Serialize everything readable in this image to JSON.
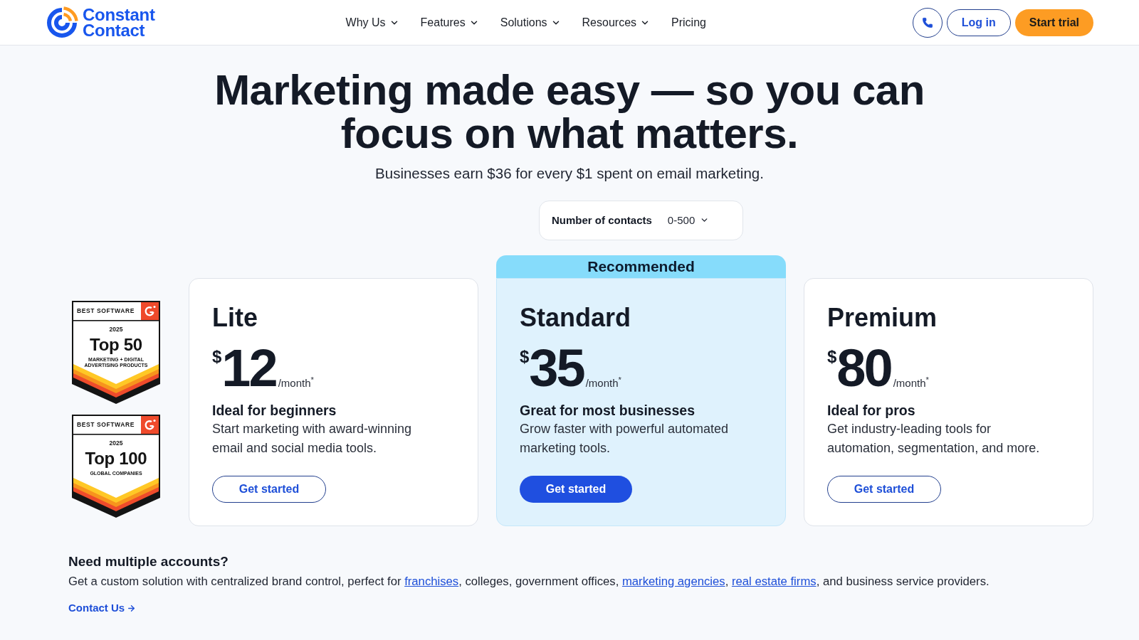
{
  "header": {
    "logo": {
      "line_1": "Constant",
      "line_2": "Contact"
    },
    "nav": [
      {
        "label": "Why Us",
        "dropdown": true
      },
      {
        "label": "Features",
        "dropdown": true
      },
      {
        "label": "Solutions",
        "dropdown": true
      },
      {
        "label": "Resources",
        "dropdown": true
      },
      {
        "label": "Pricing",
        "dropdown": false
      }
    ],
    "login": "Log in",
    "cta": "Start trial"
  },
  "hero": {
    "title": "Marketing made easy — so you can focus on what matters.",
    "subtitle": "Businesses earn $36 for every $1 spent on email marketing."
  },
  "contacts_selector": {
    "label": "Number of contacts",
    "value": "0-500"
  },
  "badges": [
    {
      "label": "BEST SOFTWARE",
      "year": "2025",
      "title": "Top 50",
      "subtitle": "MARKETING + DIGITAL ADVERTISING PRODUCTS"
    },
    {
      "label": "BEST SOFTWARE",
      "year": "2025",
      "title": "Top 100",
      "subtitle": "GLOBAL COMPANIES"
    }
  ],
  "plans": [
    {
      "name": "Lite",
      "currency": "$",
      "price": "12",
      "period": "/month$^{*}$",
      "tagline": "Ideal for beginners",
      "description": "Start marketing with award-winning email and social media tools.",
      "button": "Get started",
      "highlighted": false
    },
    {
      "name": "Standard",
      "ribbon": "Recommended",
      "currency": "$",
      "price": "35",
      "period": "/month$^{*}$",
      "tagline": "Great for most businesses",
      "description": "Grow faster with powerful automated marketing tools.",
      "button": "Get started",
      "highlighted": true
    },
    {
      "name": "Premium",
      "currency": "$",
      "price": "80",
      "period": "/month$^{*}$",
      "tagline": "Ideal for pros",
      "description": "Get industry-leading tools for automation, segmentation, and more.",
      "button": "Get started",
      "highlighted": false
    }
  ],
  "multiple_accounts": {
    "heading": "Need multiple accounts?",
    "description": [
      {
        "kind": "text",
        "text": "Get a custom solution with centralized brand control, perfect for "
      },
      {
        "kind": "link",
        "text": "franchises"
      },
      {
        "kind": "text",
        "text": ", colleges, government offices, "
      },
      {
        "kind": "link",
        "text": "marketing agencies"
      },
      {
        "kind": "text",
        "text": ", "
      },
      {
        "kind": "link",
        "text": "real estate firms"
      },
      {
        "kind": "text",
        "text": ", and business service providers."
      }
    ],
    "link": "Contact Us"
  }
}
